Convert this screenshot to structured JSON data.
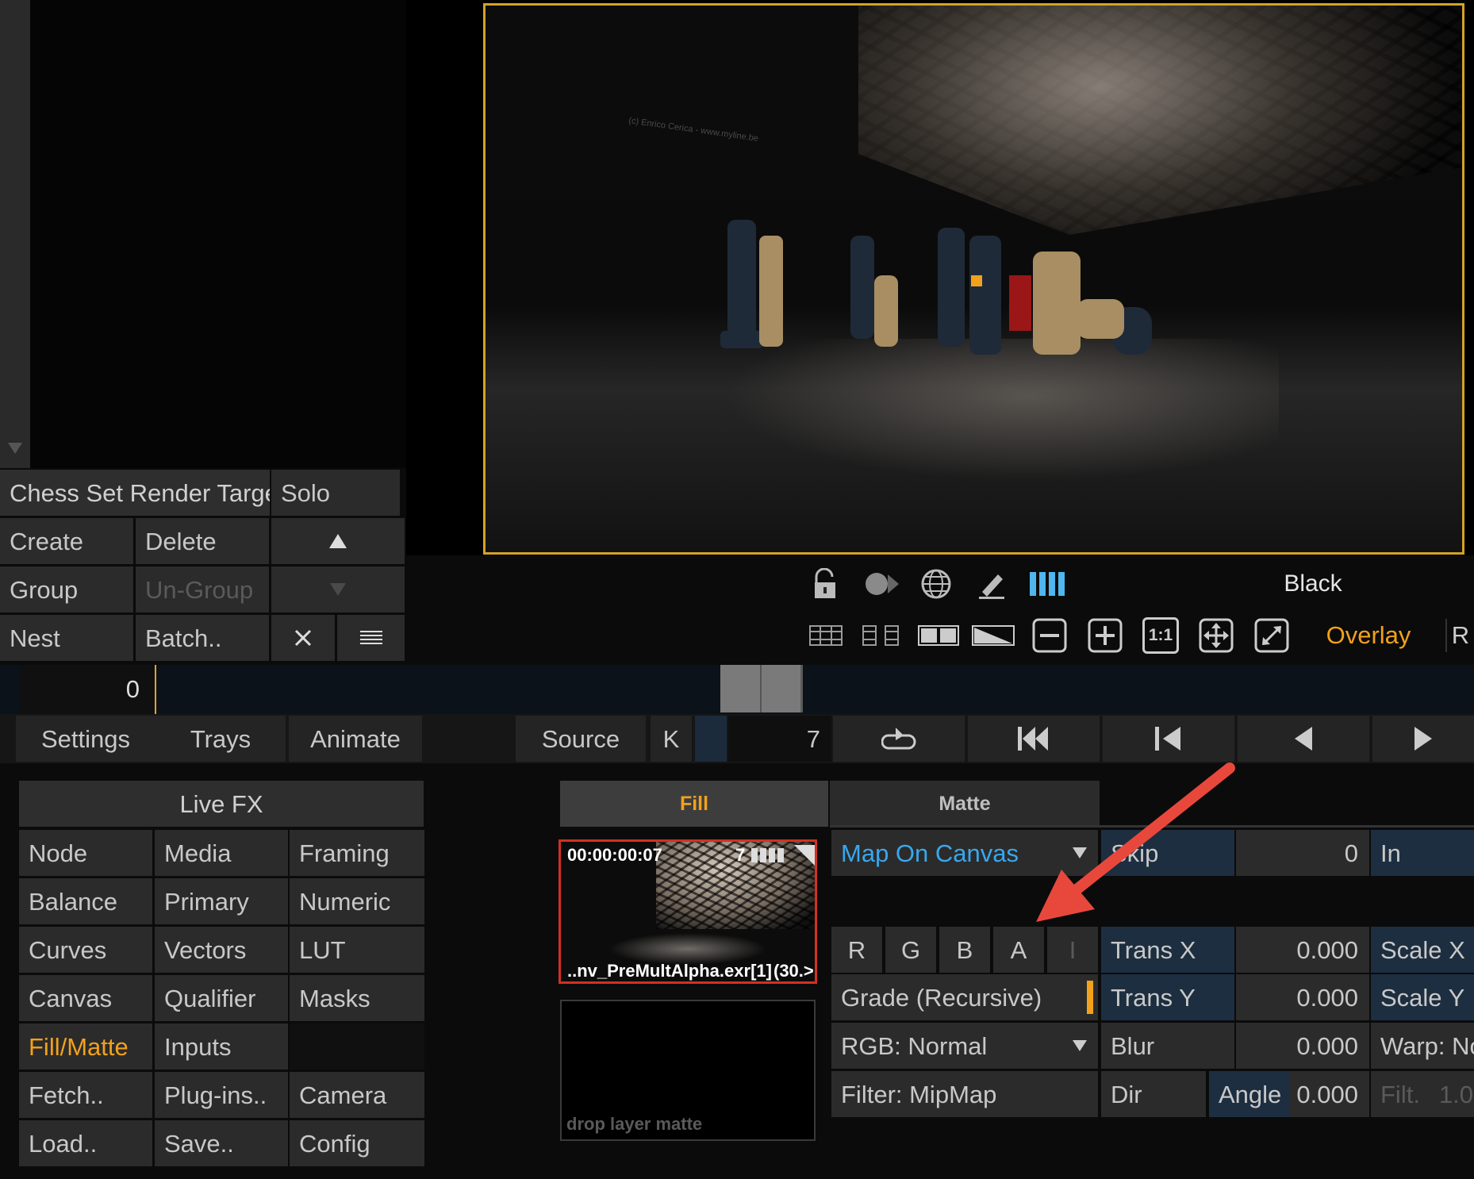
{
  "layer_panel": {
    "layer_name": "Chess Set Render Targe",
    "solo_label": "Solo",
    "buttons": {
      "create": "Create",
      "delete": "Delete",
      "group": "Group",
      "ungroup": "Un-Group",
      "nest": "Nest",
      "batch": "Batch.."
    }
  },
  "viewer": {
    "watermark": "(c) Enrico Cerica - www.myline.be",
    "background_label": "Black",
    "overlay_label": "Overlay",
    "r_label": "R",
    "zoom_one_to_one": "1:1"
  },
  "timeline": {
    "frame_value": "0"
  },
  "transport": {
    "settings": "Settings",
    "trays": "Trays",
    "animate": "Animate",
    "source": "Source",
    "k": "K",
    "frame": "7"
  },
  "livefx": {
    "title": "Live FX",
    "items": [
      {
        "label": "Node"
      },
      {
        "label": "Media"
      },
      {
        "label": "Framing"
      },
      {
        "label": "Balance"
      },
      {
        "label": "Primary"
      },
      {
        "label": "Numeric"
      },
      {
        "label": "Curves"
      },
      {
        "label": "Vectors"
      },
      {
        "label": "LUT"
      },
      {
        "label": "Canvas"
      },
      {
        "label": "Qualifier"
      },
      {
        "label": "Masks"
      },
      {
        "label": "Fill/Matte"
      },
      {
        "label": "Inputs"
      },
      {
        "label": "Fetch.."
      },
      {
        "label": "Plug-ins.."
      },
      {
        "label": "Camera"
      },
      {
        "label": "Load.."
      },
      {
        "label": "Save.."
      },
      {
        "label": "Config"
      }
    ],
    "active": "Fill/Matte",
    "active_color": "#f2a11c"
  },
  "fill_matte": {
    "tabs": {
      "fill": "Fill",
      "matte": "Matte"
    },
    "clip": {
      "timecode": "00:00:00:07",
      "frame": "7",
      "filename": "..nv_PreMultAlpha.exr[1]",
      "count": "(30.>"
    },
    "drop_label": "drop layer matte",
    "map_mode": "Map On Canvas",
    "skip_label": "Skip",
    "skip_value": "0",
    "in_label": "In",
    "channels": [
      "R",
      "G",
      "B",
      "A",
      "I"
    ],
    "grade": "Grade (Recursive)",
    "rgb_mode": "RGB: Normal",
    "filter": "Filter: MipMap",
    "params": {
      "trans_x_label": "Trans X",
      "trans_x": "0.000",
      "trans_y_label": "Trans Y",
      "trans_y": "0.000",
      "blur_label": "Blur",
      "blur": "0.000",
      "dir_label": "Dir",
      "angle_label": "Angle",
      "angle": "0.000",
      "scale_x_label": "Scale X",
      "scale_y_label": "Scale Y",
      "warp_label": "Warp: No",
      "filt_label": "Filt.",
      "filt_value": "1.0"
    }
  },
  "colors": {
    "accent_orange": "#f2a11c",
    "accent_blue": "#38a8ee",
    "annotation_arrow": "#e8483c"
  }
}
